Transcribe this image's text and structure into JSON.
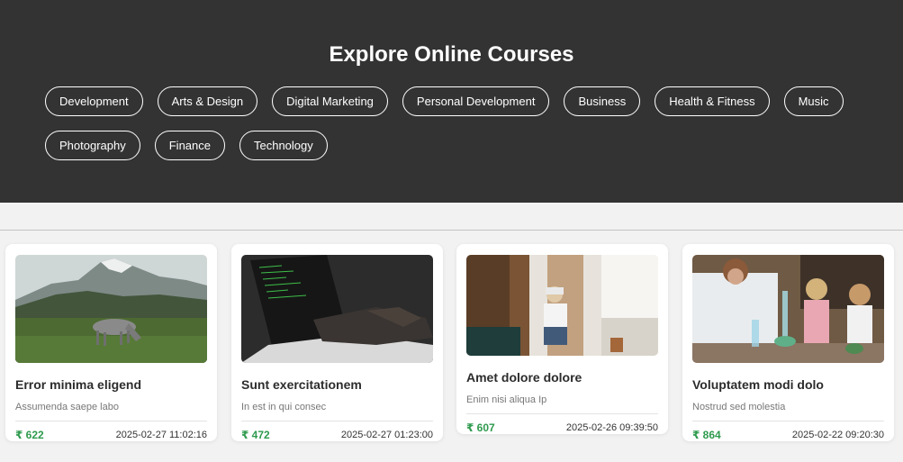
{
  "header": {
    "title": "Explore Online Courses",
    "categories": [
      "Development",
      "Arts & Design",
      "Digital Marketing",
      "Personal Development",
      "Business",
      "Health & Fitness",
      "Music",
      "Photography",
      "Finance",
      "Technology"
    ]
  },
  "courses": [
    {
      "title": "Error minima eligend",
      "subtitle": "Assumenda saepe labo",
      "price": "₹ 622",
      "date": "2025-02-27 11:02:16",
      "image": "mountain-horse-image"
    },
    {
      "title": "Sunt exercitationem",
      "subtitle": "In est in qui consec",
      "price": "₹ 472",
      "date": "2025-02-27 01:23:00",
      "image": "laptop-coding-image"
    },
    {
      "title": "Amet dolore dolore",
      "subtitle": "Enim nisi aliqua Ip",
      "price": "₹ 607",
      "date": "2025-02-26 09:39:50",
      "image": "vr-headset-room-image"
    },
    {
      "title": "Voluptatem modi dolo",
      "subtitle": "Nostrud sed molestia",
      "price": "₹ 864",
      "date": "2025-02-22 09:20:30",
      "image": "science-lab-image"
    }
  ],
  "colors": {
    "hero_bg": "#333333",
    "price": "#2e9a4e",
    "page_bg": "#f2f2f2"
  }
}
